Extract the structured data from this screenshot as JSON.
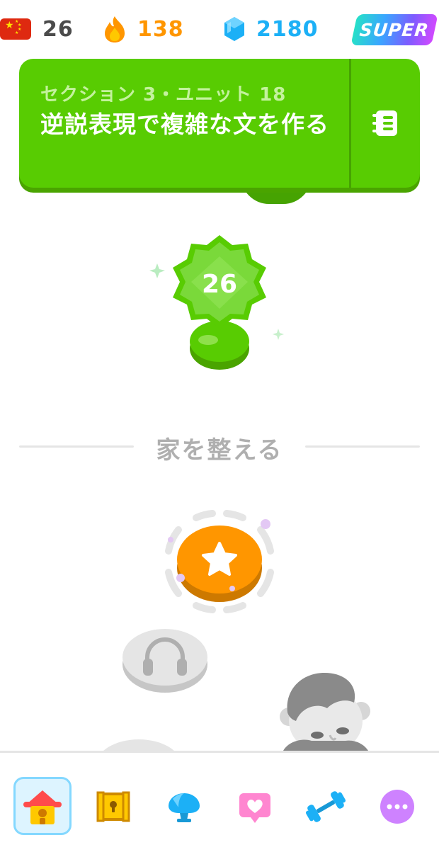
{
  "status_bar": {
    "language": {
      "icon": "china-flag-icon",
      "value": "26"
    },
    "streak": {
      "icon": "flame-icon",
      "value": "138",
      "color": "#ff9600"
    },
    "gems": {
      "icon": "gem-icon",
      "value": "2180",
      "color": "#1cb0f6"
    },
    "super_badge": {
      "label": "SUPER"
    }
  },
  "unit_header": {
    "kicker": "セクション 3・ユニット 18",
    "title": "逆説表現で複雑な文を作る",
    "guidebook_icon": "guidebook-icon",
    "color": "#58cc02"
  },
  "path": {
    "trophy_badge": {
      "icon": "trophy-badge-icon",
      "number": "26"
    },
    "section_divider": {
      "label": "家を整える"
    },
    "nodes": [
      {
        "icon": "star-icon",
        "state": "current",
        "color": "#ff9600"
      },
      {
        "icon": "headphones-icon",
        "state": "locked",
        "color": "#e5e5e5"
      },
      {
        "icon": "lesson-icon",
        "state": "locked",
        "color": "#e5e5e5"
      }
    ],
    "character": {
      "icon": "character-icon",
      "state": "grayscale"
    }
  },
  "bottom_nav": {
    "items": [
      {
        "icon": "home-icon",
        "active": true
      },
      {
        "icon": "treasure-chest-icon",
        "active": false
      },
      {
        "icon": "leaderboard-shell-icon",
        "active": false
      },
      {
        "icon": "heart-letter-icon",
        "active": false
      },
      {
        "icon": "dumbbell-icon",
        "active": false
      },
      {
        "icon": "more-icon",
        "active": false
      }
    ]
  }
}
